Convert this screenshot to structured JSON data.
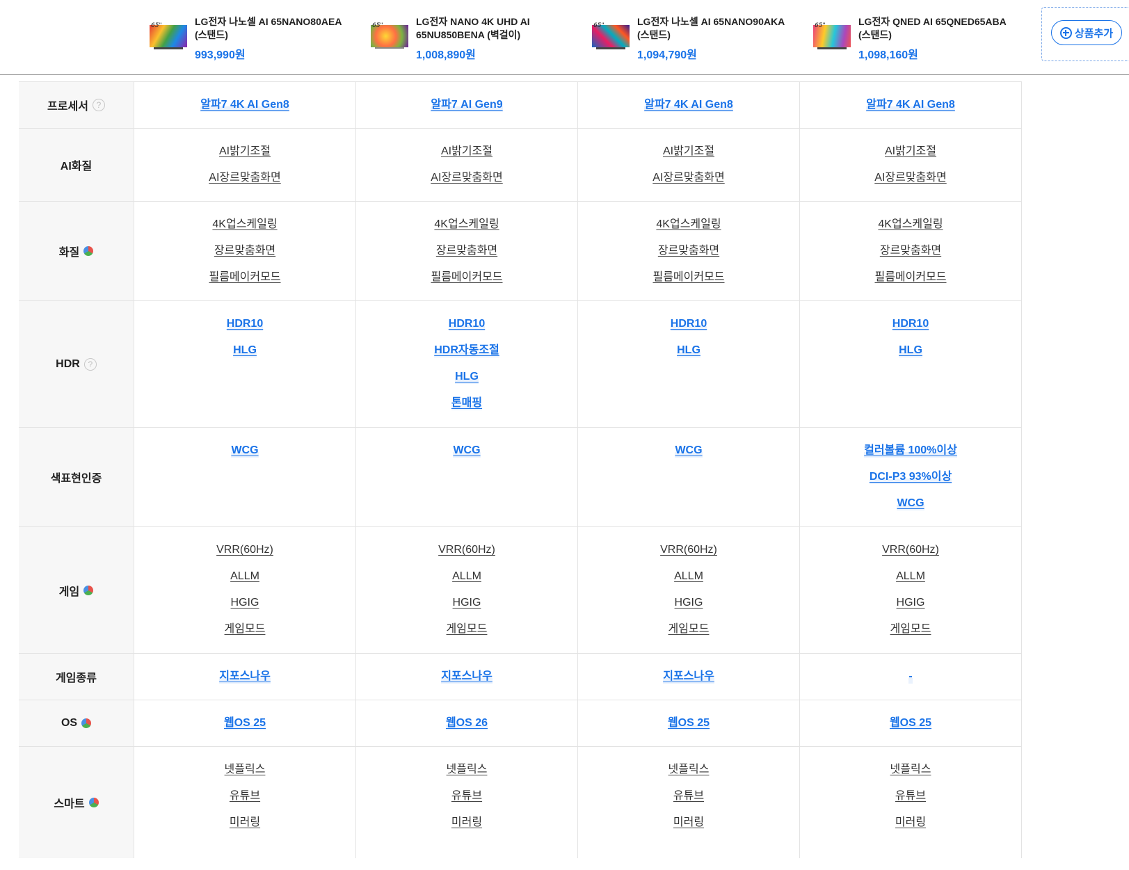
{
  "products": [
    {
      "name": "LG전자 나노셀 AI 65NANO80AEA (스탠드)",
      "price": "993,990원",
      "badge": "65\""
    },
    {
      "name": "LG전자 NANO 4K UHD AI 65NU850BENA (벽걸이)",
      "price": "1,008,890원",
      "badge": "65\""
    },
    {
      "name": "LG전자 나노셀 AI 65NANO90AKA (스탠드)",
      "price": "1,094,790원",
      "badge": "65\""
    },
    {
      "name": "LG전자 QNED AI 65QNED65ABA (스탠드)",
      "price": "1,098,160원",
      "badge": "65\""
    }
  ],
  "add_button": {
    "label": "상품추가"
  },
  "rows": [
    {
      "label": "프로세서",
      "icon": "help-icon",
      "style": "link",
      "height": 67,
      "cols": [
        [
          "알파7 4K AI Gen8"
        ],
        [
          "알파7 AI Gen9"
        ],
        [
          "알파7 4K AI Gen8"
        ],
        [
          "알파7 4K AI Gen8"
        ]
      ]
    },
    {
      "label": "AI화질",
      "icon": "",
      "style": "plain",
      "height": 105,
      "cols": [
        [
          "AI밝기조절",
          "AI장르맞춤화면"
        ],
        [
          "AI밝기조절",
          "AI장르맞춤화면"
        ],
        [
          "AI밝기조절",
          "AI장르맞춤화면"
        ],
        [
          "AI밝기조절",
          "AI장르맞춤화면"
        ]
      ]
    },
    {
      "label": "화질",
      "icon": "color-icon",
      "style": "plain",
      "height": 143,
      "cols": [
        [
          "4K업스케일링",
          "장르맞춤화면",
          "필름메이커모드"
        ],
        [
          "4K업스케일링",
          "장르맞춤화면",
          "필름메이커모드"
        ],
        [
          "4K업스케일링",
          "장르맞춤화면",
          "필름메이커모드"
        ],
        [
          "4K업스케일링",
          "장르맞춤화면",
          "필름메이커모드"
        ]
      ]
    },
    {
      "label": "HDR",
      "icon": "help-icon",
      "style": "link",
      "height": 182,
      "cols": [
        [
          "HDR10",
          "HLG"
        ],
        [
          "HDR10",
          "HDR자동조절",
          "HLG",
          "톤매핑"
        ],
        [
          "HDR10",
          "HLG"
        ],
        [
          "HDR10",
          "HLG"
        ]
      ]
    },
    {
      "label": "색표현인증",
      "icon": "",
      "style": "link",
      "height": 143,
      "cols": [
        [
          "WCG"
        ],
        [
          "WCG"
        ],
        [
          "WCG"
        ],
        [
          "컬러볼륨 100%이상",
          "DCI-P3 93%이상",
          "WCG"
        ]
      ]
    },
    {
      "label": "게임",
      "icon": "color-icon",
      "style": "plain",
      "height": 182,
      "cols": [
        [
          "VRR(60Hz)",
          "ALLM",
          "HGIG",
          "게임모드"
        ],
        [
          "VRR(60Hz)",
          "ALLM",
          "HGIG",
          "게임모드"
        ],
        [
          "VRR(60Hz)",
          "ALLM",
          "HGIG",
          "게임모드"
        ],
        [
          "VRR(60Hz)",
          "ALLM",
          "HGIG",
          "게임모드"
        ]
      ]
    },
    {
      "label": "게임종류",
      "icon": "",
      "style": "link",
      "height": 67,
      "cols": [
        [
          "지포스나우"
        ],
        [
          "지포스나우"
        ],
        [
          "지포스나우"
        ],
        [
          "-"
        ]
      ]
    },
    {
      "label": "OS",
      "icon": "color-icon",
      "style": "link",
      "height": 67,
      "cols": [
        [
          "웹OS 25"
        ],
        [
          "웹OS 26"
        ],
        [
          "웹OS 25"
        ],
        [
          "웹OS 25"
        ]
      ]
    },
    {
      "label": "스마트",
      "icon": "color-icon",
      "style": "plain",
      "height": 160,
      "cols": [
        [
          "넷플릭스",
          "유튜브",
          "미러링"
        ],
        [
          "넷플릭스",
          "유튜브",
          "미러링"
        ],
        [
          "넷플릭스",
          "유튜브",
          "미러링"
        ],
        [
          "넷플릭스",
          "유튜브",
          "미러링"
        ]
      ]
    }
  ],
  "colors": {
    "accent": "#1a73e8",
    "label_bg": "#f7f7f7",
    "border": "#e3e3e3"
  },
  "help_glyph": "?"
}
